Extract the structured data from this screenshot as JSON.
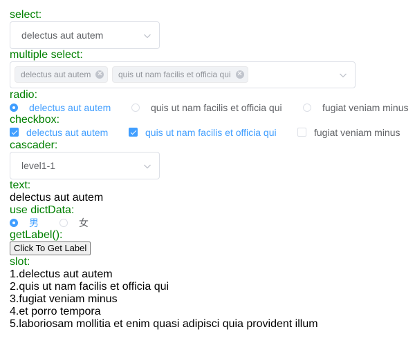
{
  "select": {
    "label": "select:",
    "value": "delectus aut autem"
  },
  "multiple_select": {
    "label": "multiple select:",
    "tags": [
      "delectus aut autem",
      "quis ut nam facilis et officia qui"
    ]
  },
  "radio": {
    "label": "radio:",
    "options": [
      "delectus aut autem",
      "quis ut nam facilis et officia qui",
      "fugiat veniam minus"
    ],
    "selected": "delectus aut autem"
  },
  "checkbox": {
    "label": "checkbox:",
    "options": [
      "delectus aut autem",
      "quis ut nam facilis et officia qui",
      "fugiat veniam minus"
    ],
    "checked": [
      "delectus aut autem",
      "quis ut nam facilis et officia qui"
    ]
  },
  "cascader": {
    "label": "cascader:",
    "value": "level1-1"
  },
  "text": {
    "label": "text:",
    "value": "delectus aut autem"
  },
  "dict": {
    "label": "use dictData:",
    "options": [
      "男",
      "女"
    ],
    "selected": "男"
  },
  "get_label": {
    "label": "getLabel():",
    "button": "Click To Get Label"
  },
  "slot": {
    "label": "slot:",
    "items": [
      "1.delectus aut autem",
      "2.quis ut nam facilis et officia qui",
      "3.fugiat veniam minus",
      "4.et porro tempora",
      "5.laboriosam mollitia et enim quasi adipisci quia provident illum"
    ]
  },
  "colors": {
    "label_green": "#008000",
    "accent_blue": "#409eff",
    "muted": "#606266",
    "border": "#dcdfe6"
  },
  "icons": {
    "dropdown": "chevron-down-icon",
    "tag_close": "close-icon",
    "check": "check-icon"
  }
}
